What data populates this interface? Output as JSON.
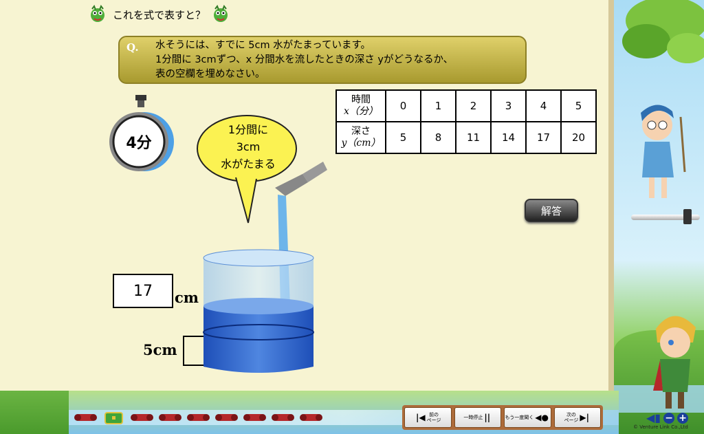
{
  "title": "これを式で表すと？",
  "question": {
    "label": "Q.",
    "text": "水そうには、すでに 5cm 水がたまっています。\n1分間に 3cmずつ、x 分間水を流したときの深さ yがどうなるか、\n表の空欄を埋めなさい。"
  },
  "timer": {
    "value": "4分"
  },
  "bubble": {
    "lines": [
      "1分間に",
      "3cm",
      "水がたまる"
    ]
  },
  "table": {
    "row1_header": [
      "時間",
      "x（分）"
    ],
    "row2_header": [
      "深さ",
      "y（cm）"
    ],
    "x": [
      "0",
      "1",
      "2",
      "3",
      "4",
      "5"
    ],
    "y": [
      "5",
      "8",
      "11",
      "14",
      "17",
      "20"
    ]
  },
  "answer_button": "解答",
  "beaker": {
    "current_label": "17",
    "unit": "cm",
    "initial_label": "5cm"
  },
  "nav": {
    "prev": "前の\nページ",
    "pause": "一時停止",
    "replay": "もう一度聞く",
    "next": "次の\nページ"
  },
  "copyright": "© Venture Link Co.,Ltd",
  "colors": {
    "paper": "#f7f4d2",
    "question_bar": "#c8b94a",
    "water": "#3a6fd0",
    "nav_frame": "#ad6b3a"
  }
}
